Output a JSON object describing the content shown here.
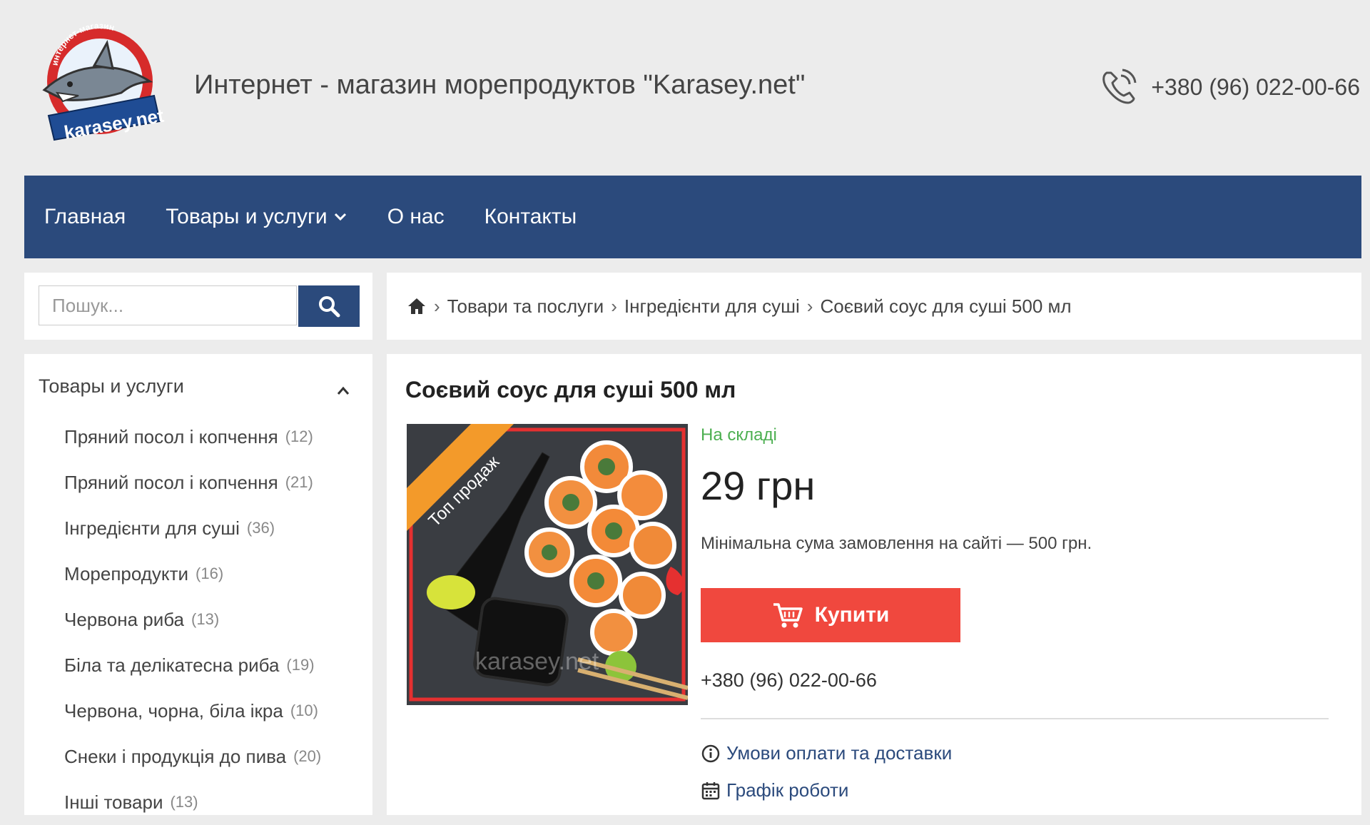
{
  "header": {
    "logo_top_text": "интернет-магазин",
    "logo_bottom_text": "karasey.net",
    "site_title": "Интернет - магазин морепродуктов \"Karasey.net\"",
    "phone": "+380 (96) 022-00-66"
  },
  "nav": {
    "items": [
      {
        "label": "Главная"
      },
      {
        "label": "Товары и услуги"
      },
      {
        "label": "О нас"
      },
      {
        "label": "Контакты"
      }
    ]
  },
  "search": {
    "placeholder": "Пошук..."
  },
  "breadcrumb": {
    "items": [
      "Товари та послуги",
      "Інгредієнти для суші",
      "Соєвий соус для суші 500 мл"
    ]
  },
  "sidebar": {
    "title": "Товары и услуги",
    "categories": [
      {
        "label": "Пряний посол і копчення",
        "count": "(12)"
      },
      {
        "label": "Пряний посол і копчення",
        "count": "(21)"
      },
      {
        "label": "Інгредієнти для суші",
        "count": "(36)"
      },
      {
        "label": "Морепродукти",
        "count": "(16)"
      },
      {
        "label": "Червона риба",
        "count": "(13)"
      },
      {
        "label": "Біла та делікатесна риба",
        "count": "(19)"
      },
      {
        "label": "Червона, чорна, біла ікра",
        "count": "(10)"
      },
      {
        "label": "Снеки і продукція до пива",
        "count": "(20)"
      },
      {
        "label": "Інші товари",
        "count": "(13)"
      }
    ]
  },
  "product": {
    "title": "Соєвий соус для суші 500 мл",
    "badge": "Топ продаж",
    "watermark": "karasey.net",
    "stock": "На складі",
    "price": "29 грн",
    "min_order": "Мінімальна сума замовлення на сайті — 500 грн.",
    "buy_label": "Купити",
    "phone": "+380 (96) 022-00-66",
    "links": {
      "delivery": "Умови оплати та доставки",
      "schedule": "Графік роботи"
    }
  },
  "colors": {
    "nav_bg": "#2b4a7c",
    "buy_btn": "#f0483e",
    "stock_green": "#4caf50"
  }
}
